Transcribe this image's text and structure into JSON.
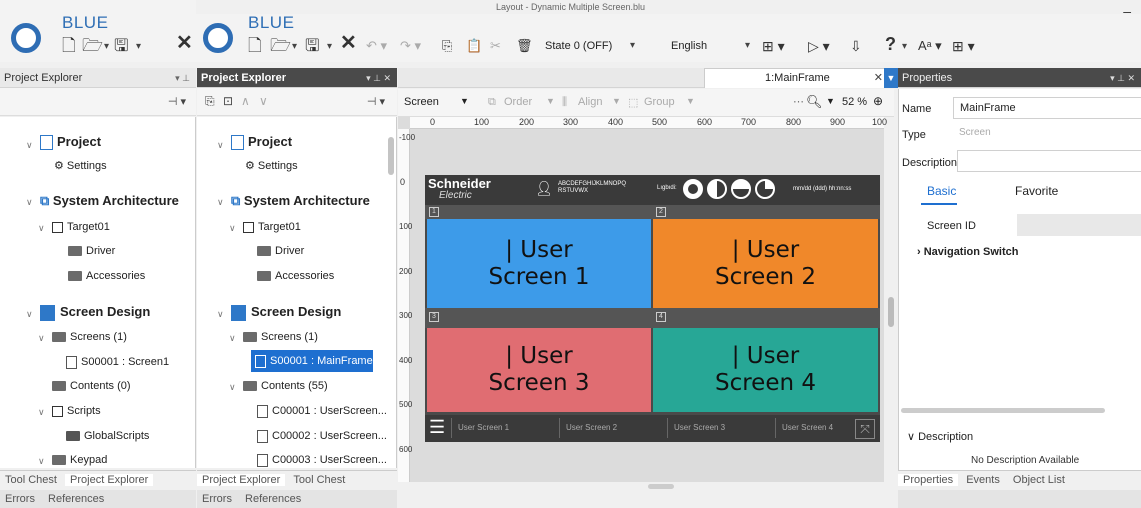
{
  "window": {
    "title": "Layout - Dynamic Multiple Screen.blu",
    "minimize": "–"
  },
  "app": {
    "brand": "BLUE"
  },
  "toolbar": {
    "state": "State 0 (OFF)",
    "language": "English",
    "help": "?"
  },
  "left_pane1": {
    "title": "Project Explorer",
    "tree": {
      "project": "Project",
      "settings": "Settings",
      "system_architecture": "System Architecture",
      "target": "Target01",
      "driver": "Driver",
      "accessories": "Accessories",
      "screen_design": "Screen Design",
      "screens": "Screens (1)",
      "screen1": "S00001 : Screen1",
      "contents": "Contents (0)",
      "scripts": "Scripts",
      "global_scripts": "GlobalScripts",
      "keypad": "Keypad"
    },
    "bottom_tabs": [
      "Tool Chest",
      "Project Explorer"
    ],
    "bottom_tabs2": [
      "Errors",
      "References"
    ]
  },
  "left_pane2": {
    "title": "Project Explorer",
    "tree": {
      "project": "Project",
      "settings": "Settings",
      "system_architecture": "System Architecture",
      "target": "Target01",
      "driver": "Driver",
      "accessories": "Accessories",
      "screen_design": "Screen Design",
      "screens": "Screens (1)",
      "mainframe": "S00001 : MainFrame",
      "contents": "Contents (55)",
      "c1": "C00001 : UserScreen...",
      "c2": "C00002 : UserScreen...",
      "c3": "C00003 : UserScreen..."
    },
    "bottom_tabs": [
      "Project Explorer",
      "Tool Chest"
    ],
    "bottom_tabs2": [
      "Errors",
      "References"
    ]
  },
  "editor": {
    "tab": "1:MainFrame",
    "toolbar": {
      "screen": "Screen",
      "order": "Order",
      "align": "Align",
      "group": "Group",
      "zoom": "52 %"
    },
    "ruler_h": [
      "0",
      "100",
      "200",
      "300",
      "400",
      "500",
      "600",
      "700",
      "800",
      "900",
      "100"
    ],
    "ruler_v": [
      "-100",
      "0",
      "100",
      "200",
      "300",
      "400",
      "500",
      "600"
    ],
    "design": {
      "brand_line1": "Schneider",
      "brand_line2": "Electric",
      "alpha": "ABCDEFGHIJKLMNOPQ\nRSTUVWX",
      "ligbidi": "Lıgbıdi:",
      "datetime": "mm/dd (ddd) hh:nn:ss",
      "cells": [
        {
          "num": "1",
          "text": "| User\nScreen 1",
          "color": "#3d9be9"
        },
        {
          "num": "2",
          "text": "| User\nScreen 2",
          "color": "#f0882a"
        },
        {
          "num": "3",
          "text": "| User\nScreen 3",
          "color": "#e06d72"
        },
        {
          "num": "4",
          "text": "| User\nScreen 4",
          "color": "#27a796"
        }
      ],
      "footer_tabs": [
        "User Screen 1",
        "User Screen 2",
        "User Screen 3",
        "User Screen 4"
      ]
    }
  },
  "properties": {
    "title": "Properties",
    "name_label": "Name",
    "name_value": "MainFrame",
    "type_label": "Type",
    "type_value": "Screen",
    "description_label": "Description",
    "tab_basic": "Basic",
    "tab_favorite": "Favorite",
    "screen_id_label": "Screen ID",
    "nav_switch": "Navigation Switch",
    "desc_section": "Description",
    "no_desc": "No Description Available",
    "bottom_tabs": [
      "Properties",
      "Events",
      "Object List"
    ]
  }
}
